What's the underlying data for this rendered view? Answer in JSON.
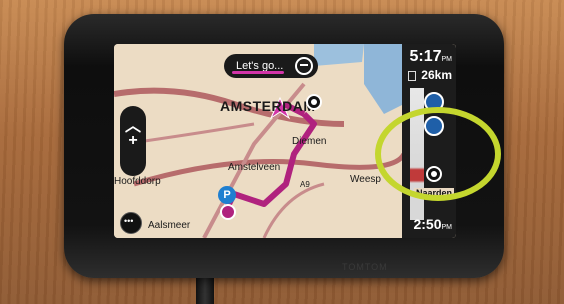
{
  "scene": {
    "description_colors": {
      "accent": "#d234a8",
      "highlight": "#c4d62e"
    }
  },
  "banner": {
    "label": "Let's go..."
  },
  "map": {
    "city": "AMSTERDAM",
    "places": [
      "Diemen",
      "Amstelveen",
      "Weesp",
      "Aalsmeer",
      "Hoofddorp"
    ]
  },
  "route_bar": {
    "arrival_time": "5:17",
    "arrival_suffix": "PM",
    "remaining_distance": "26km",
    "destination": "Naarden",
    "current_time": "2:50",
    "current_suffix": "PM"
  },
  "road_labels": [
    "A9"
  ]
}
